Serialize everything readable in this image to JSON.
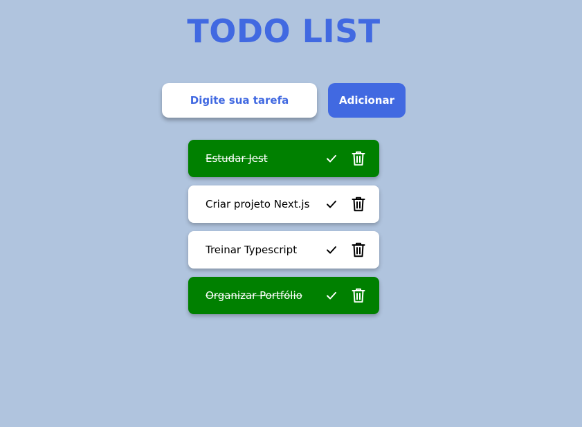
{
  "header": {
    "title": "TODO LIST"
  },
  "form": {
    "input_placeholder": "Digite sua tarefa",
    "input_value": "",
    "add_label": "Adicionar"
  },
  "todos": [
    {
      "text": "Estudar Jest",
      "completed": true
    },
    {
      "text": "Criar projeto Next.js",
      "completed": false
    },
    {
      "text": "Treinar Typescript",
      "completed": false
    },
    {
      "text": "Organizar Portfólio",
      "completed": true
    }
  ],
  "icons": {
    "complete": "check-icon",
    "delete": "trash-icon"
  },
  "colors": {
    "background": "#b0c4de",
    "accent": "#4169e1",
    "completed": "#008000",
    "item_background": "#ffffff"
  }
}
